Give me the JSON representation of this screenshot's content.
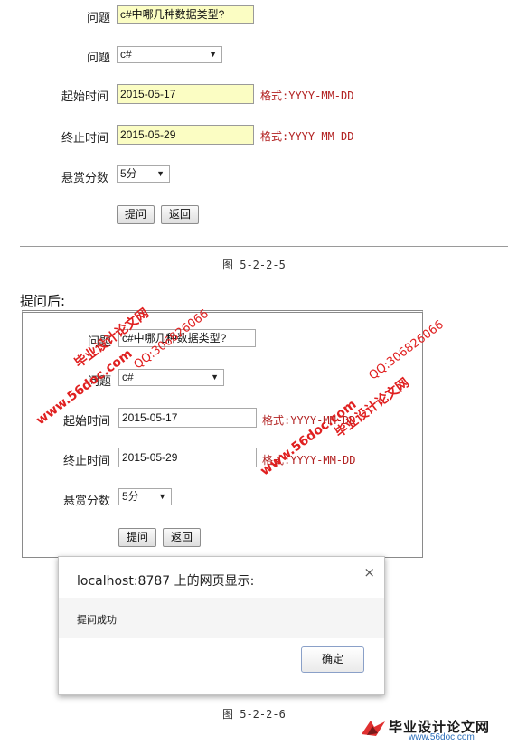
{
  "top_form": {
    "question_label": "问题",
    "question_value": "c#中哪几种数据类型?",
    "category_label": "问题",
    "category_value": "c#",
    "start_label": "起始时间",
    "start_value": "2015-05-17",
    "start_hint": "格式:YYYY-MM-DD",
    "end_label": "终止时间",
    "end_value": "2015-05-29",
    "end_hint": "格式:YYYY-MM-DD",
    "reward_label": "悬赏分数",
    "reward_value": "5分",
    "submit_label": "提问",
    "back_label": "返回"
  },
  "caption_1": "图 5-2-2-5",
  "section_heading": "提问后:",
  "bottom_form": {
    "question_label": "问题",
    "question_value": "c#中哪几种数据类型?",
    "category_label": "问题",
    "category_value": "c#",
    "start_label": "起始时间",
    "start_value": "2015-05-17",
    "start_hint": "格式:YYYY-MM-DD",
    "end_label": "终止时间",
    "end_value": "2015-05-29",
    "end_hint": "格式:YYYY-MM-DD",
    "reward_label": "悬赏分数",
    "reward_value": "5分",
    "submit_label": "提问",
    "back_label": "返回"
  },
  "dialog": {
    "title": "localhost:8787 上的网页显示:",
    "message": "提问成功",
    "ok_label": "确定",
    "close_icon": "close-icon"
  },
  "caption_2": "图 5-2-2-6",
  "watermarks": {
    "site_url": "www.56doc.com",
    "site_name": "毕业设计论文网",
    "qq": "QQ:306826066",
    "footer_logo_text": "毕业设计论文网",
    "footer_logo_url": "www.56doc.com"
  },
  "colors": {
    "hint_red": "#b22222",
    "highlight_yellow": "#fbfdc3",
    "watermark_red": "#e02020"
  }
}
